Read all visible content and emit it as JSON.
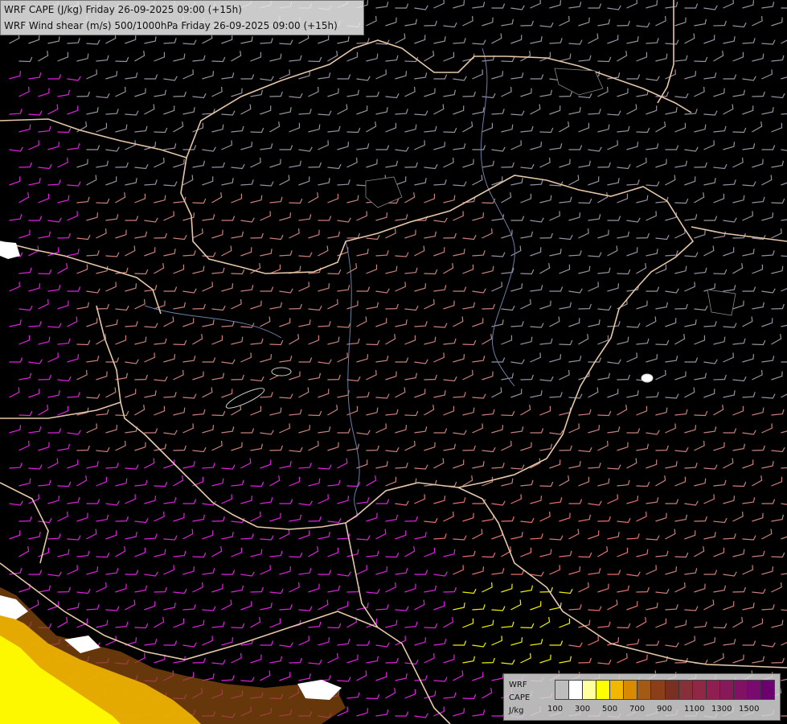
{
  "titles": {
    "line1": "WRF CAPE (J/kg) Friday 26-09-2025 09:00 (+15h)",
    "line2": "WRF Wind shear (m/s) 500/1000hPa Friday 26-09-2025 09:00 (+15h)"
  },
  "legend": {
    "label_model": "WRF",
    "label_field": "CAPE",
    "label_unit": "J/kg",
    "tick_labels": [
      "100",
      "300",
      "500",
      "700",
      "900",
      "1100",
      "1300",
      "1500"
    ],
    "colors": [
      "#bdbdbd",
      "#ffffff",
      "#ffffa0",
      "#ffff00",
      "#f2b700",
      "#d88a00",
      "#a25a14",
      "#8a3f18",
      "#7a3020",
      "#86303a",
      "#8f2845",
      "#8e1f50",
      "#87185a",
      "#801165",
      "#790a70",
      "#6d0070"
    ]
  },
  "colors": {
    "background": "#000000",
    "borders": "#e6c8a8",
    "rivers": "#6a7fa8",
    "barb_weak": "#9a8fa0",
    "barb_mid": "#c9807a",
    "barb_strong": "#e8706e",
    "barb_extreme": "#e020e0",
    "barb_cape": "#f0f000"
  }
}
